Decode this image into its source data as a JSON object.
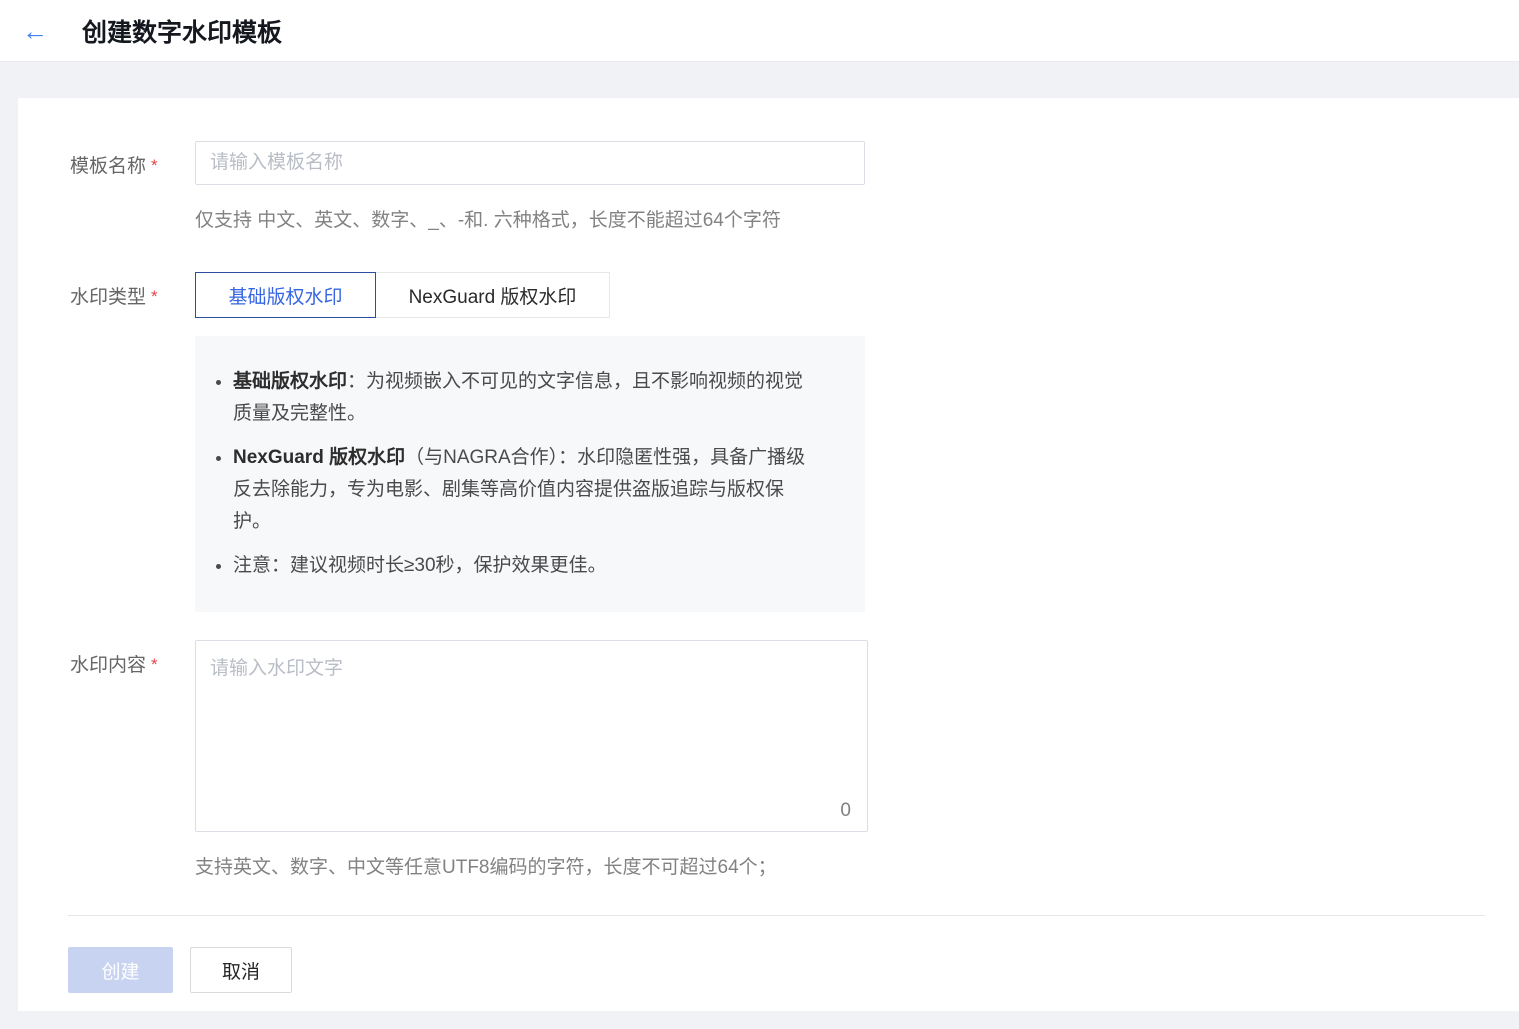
{
  "header": {
    "back_icon": "←",
    "title": "创建数字水印模板"
  },
  "form": {
    "template_name": {
      "label": "模板名称",
      "required_mark": "*",
      "value": "",
      "placeholder": "请输入模板名称",
      "helper": "仅支持 中文、英文、数字、_、-和. 六种格式，长度不能超过64个字符"
    },
    "watermark_type": {
      "label": "水印类型",
      "required_mark": "*",
      "options": [
        {
          "label": "基础版权水印",
          "selected": true
        },
        {
          "label": "NexGuard 版权水印",
          "selected": false
        }
      ],
      "notes": [
        {
          "bold": "基础版权水印",
          "text": "：为视频嵌入不可见的文字信息，且不影响视频的视觉质量及完整性。"
        },
        {
          "bold": "NexGuard 版权水印",
          "text": "（与NAGRA合作）：水印隐匿性强，具备广播级反去除能力，专为电影、剧集等高价值内容提供盗版追踪与版权保护。"
        },
        {
          "bold": "",
          "text": "注意：建议视频时长≥30秒，保护效果更佳。"
        }
      ]
    },
    "watermark_content": {
      "label": "水印内容",
      "required_mark": "*",
      "value": "",
      "placeholder": "请输入水印文字",
      "char_count": "0",
      "helper": "支持英文、数字、中文等任意UTF8编码的字符，长度不可超过64个；"
    }
  },
  "footer": {
    "create_label": "创建",
    "cancel_label": "取消"
  },
  "colors": {
    "accent_blue": "#3766e3",
    "selected_tab_border": "#2a4fa0",
    "required_red": "#e54545",
    "back_arrow_blue": "#4481f7",
    "disabled_primary_bg": "#c7d3f0",
    "page_bg": "#f1f2f6",
    "info_box_bg": "#f7f8fa"
  }
}
